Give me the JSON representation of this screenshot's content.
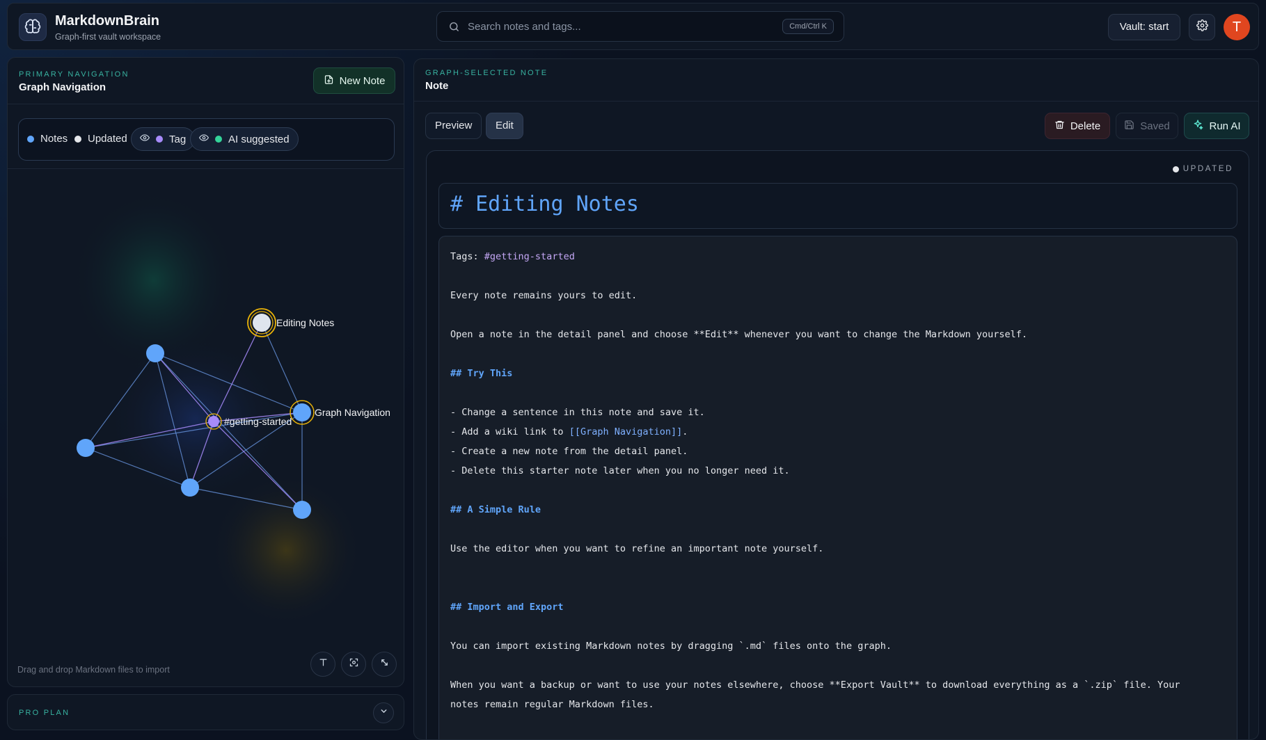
{
  "app": {
    "name": "MarkdownBrain",
    "subtitle": "Graph-first vault workspace"
  },
  "search": {
    "placeholder": "Search notes and tags...",
    "shortcut": "Cmd/Ctrl K"
  },
  "header": {
    "vault_label": "Vault: start",
    "avatar_initial": "T"
  },
  "left_panel": {
    "eyebrow": "PRIMARY NAVIGATION",
    "title": "Graph Navigation",
    "new_note_label": "New Note",
    "legend": {
      "notes": "Notes",
      "updated": "Updated",
      "tag": "Tag",
      "ai_suggested": "AI suggested"
    },
    "graph": {
      "labels": {
        "editing_notes": "Editing Notes",
        "getting_started": "#getting-started",
        "graph_navigation": "Graph Navigation"
      }
    },
    "hint": "Drag and drop Markdown files to import"
  },
  "pro_plan": {
    "label": "PRO PLAN"
  },
  "right_panel": {
    "eyebrow": "GRAPH-SELECTED NOTE",
    "title": "Note",
    "tabs": [
      "Preview",
      "Edit"
    ],
    "actions": {
      "delete": "Delete",
      "saved": "Saved",
      "run_ai": "Run AI"
    },
    "status_badge": "UPDATED",
    "note_title": "# Editing Notes",
    "body": {
      "tags_prefix": "Tags: ",
      "tag": "#getting-started",
      "line1": "Every note remains yours to edit.",
      "line2": "Open a note in the detail panel and choose **Edit** whenever you want to change the Markdown yourself.",
      "h_try": "## Try This",
      "li1": "- Change a sentence in this note and save it.",
      "li2_prefix": "- Add a wiki link to ",
      "li2_link": "[[Graph Navigation]]",
      "li2_suffix": ".",
      "li3": "- Create a new note from the detail panel.",
      "li4": "- Delete this starter note later when you no longer need it.",
      "h_rule": "## A Simple Rule",
      "rule": "Use the editor when you want to refine an important note yourself.",
      "h_import": "## Import and Export",
      "import": "You can import existing Markdown notes by dragging `.md` files onto the graph.",
      "export1": "When you want a backup or want to use your notes elsewhere, choose **Export Vault** to download everything as a `.zip` file. Your",
      "export2": "notes remain regular Markdown files."
    }
  },
  "colors": {
    "accent_teal": "#38b2a0",
    "note_blue": "#60a5fa",
    "tag_purple": "#a78bfa",
    "ai_green": "#34d399",
    "highlight_ring": "#eab308",
    "avatar": "#e0461f"
  }
}
